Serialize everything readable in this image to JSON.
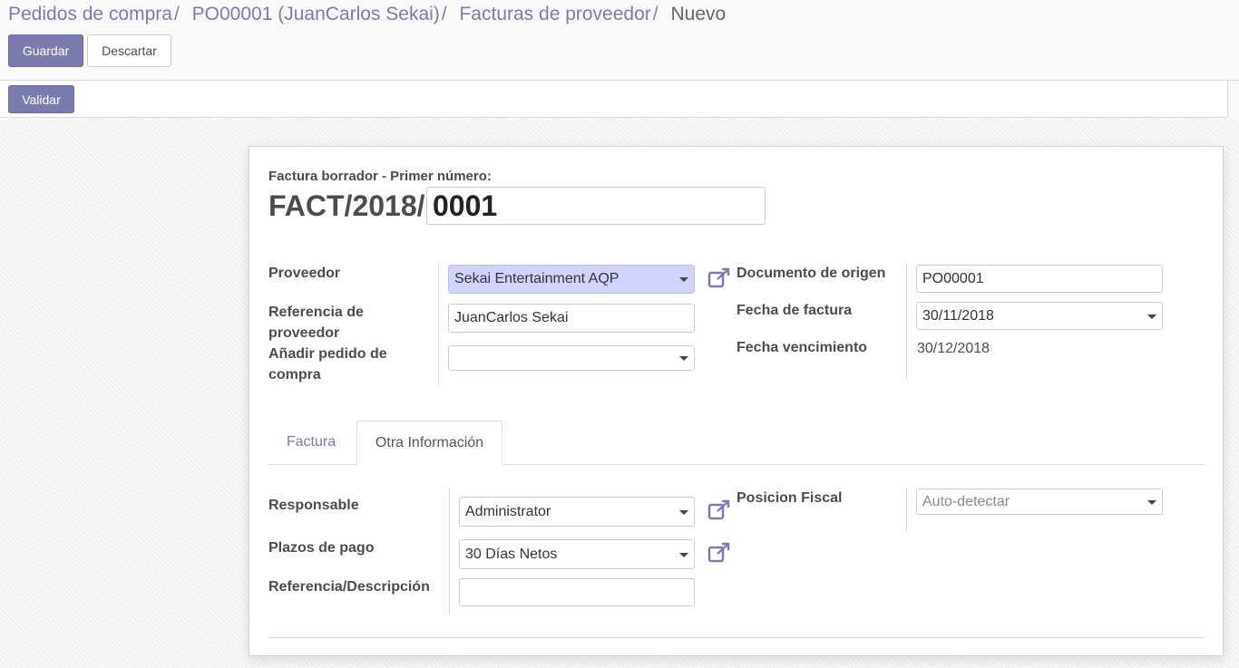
{
  "breadcrumb": {
    "items": [
      "Pedidos de compra",
      "PO00001 (JuanCarlos Sekai)",
      "Facturas de proveedor"
    ],
    "separator": "/",
    "active": "Nuevo"
  },
  "toolbar": {
    "save_label": "Guardar",
    "discard_label": "Descartar"
  },
  "statusbar": {
    "validate_label": "Validar"
  },
  "invoice": {
    "title_label": "Factura borrador  - Primer número:",
    "prefix": "FACT/2018/",
    "number": "0001"
  },
  "form": {
    "left": {
      "supplier_label": "Proveedor",
      "supplier_value": "Sekai Entertainment AQP",
      "reference_label": "Referencia de proveedor",
      "reference_value": "JuanCarlos Sekai",
      "add_po_label": "Añadir pedido de compra",
      "add_po_value": ""
    },
    "right": {
      "origin_label": "Documento de origen",
      "origin_value": "PO00001",
      "invoice_date_label": "Fecha de factura",
      "invoice_date_value": "30/11/2018",
      "due_date_label": "Fecha vencimiento",
      "due_date_value": "30/12/2018"
    }
  },
  "tabs": [
    {
      "label": "Factura",
      "active": false
    },
    {
      "label": "Otra Información",
      "active": true
    }
  ],
  "other_info": {
    "responsible_label": "Responsable",
    "responsible_value": "Administrator",
    "payment_terms_label": "Plazos de pago",
    "payment_terms_value": "30 Días Netos",
    "ref_desc_label": "Referencia/Descripción",
    "ref_desc_value": "",
    "fiscal_position_label": "Posicion Fiscal",
    "fiscal_position_placeholder": "Auto-detectar"
  },
  "colors": {
    "primary": "#7c7bad",
    "highlight_field": "#d2d2ff"
  },
  "icons": [
    "external-link-icon",
    "dropdown-caret-icon"
  ]
}
